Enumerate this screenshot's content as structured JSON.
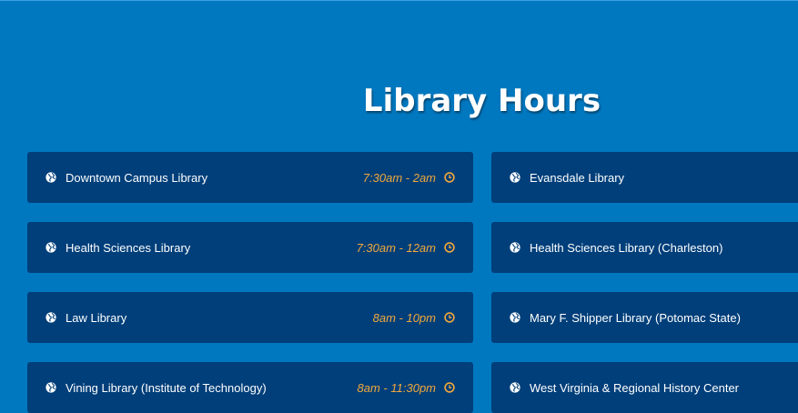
{
  "title": "Library Hours",
  "colors": {
    "background": "#0078c0",
    "card": "#003f7a",
    "hours_accent": "#f2a83b",
    "text": "#ffffff"
  },
  "icons": {
    "location": "globe-icon",
    "hours": "clock-icon"
  },
  "libraries_left": [
    {
      "name": "Downtown Campus Library",
      "hours": "7:30am - 2am"
    },
    {
      "name": "Health Sciences Library",
      "hours": "7:30am - 12am"
    },
    {
      "name": "Law Library",
      "hours": "8am - 10pm"
    },
    {
      "name": "Vining Library (Institute of Technology)",
      "hours": "8am - 11:30pm"
    }
  ],
  "libraries_right": [
    {
      "name": "Evansdale Library"
    },
    {
      "name": "Health Sciences Library (Charleston)"
    },
    {
      "name": "Mary F. Shipper Library (Potomac State)"
    },
    {
      "name": "West Virginia & Regional History Center"
    }
  ]
}
